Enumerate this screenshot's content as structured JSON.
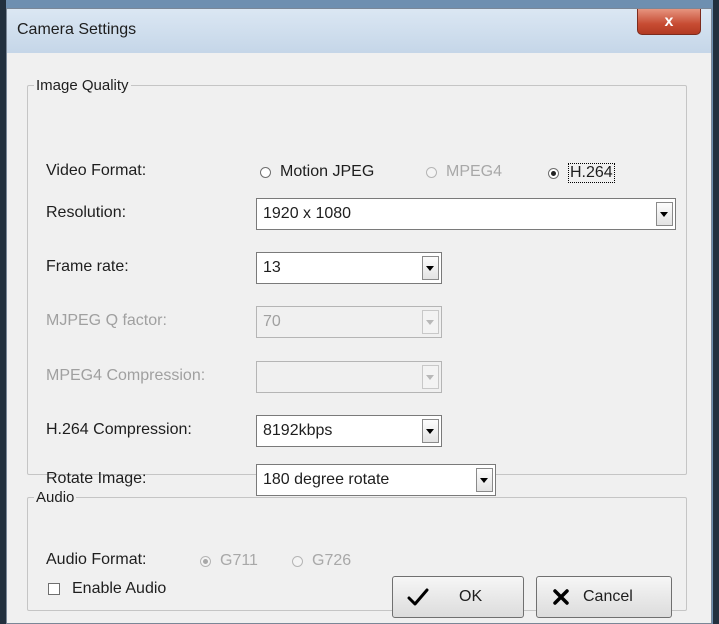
{
  "window": {
    "title": "Camera Settings",
    "close_label": "x"
  },
  "image_quality": {
    "legend": "Image Quality",
    "video_format": {
      "label": "Video Format:",
      "options": [
        {
          "label": "Motion JPEG",
          "selected": false,
          "enabled": true
        },
        {
          "label": "MPEG4",
          "selected": false,
          "enabled": false
        },
        {
          "label": "H.264",
          "selected": true,
          "enabled": true
        }
      ]
    },
    "resolution": {
      "label": "Resolution:",
      "value": "1920 x 1080"
    },
    "frame_rate": {
      "label": "Frame rate:",
      "value": "13"
    },
    "mjpeg_q": {
      "label": "MJPEG Q factor:",
      "value": "70",
      "enabled": false
    },
    "mpeg4_compression": {
      "label": "MPEG4 Compression:",
      "value": "",
      "enabled": false
    },
    "h264_compression": {
      "label": "H.264 Compression:",
      "value": "8192kbps"
    },
    "rotate_image": {
      "label": "Rotate Image:",
      "value": "180 degree rotate"
    }
  },
  "audio": {
    "legend": "Audio",
    "audio_format": {
      "label": "Audio Format:",
      "options": [
        {
          "label": "G711",
          "selected": true,
          "enabled": false
        },
        {
          "label": "G726",
          "selected": false,
          "enabled": false
        }
      ]
    },
    "enable_audio": {
      "label": "Enable Audio",
      "checked": false
    }
  },
  "buttons": {
    "ok": "OK",
    "cancel": "Cancel"
  },
  "colors": {
    "title_bar": "#c5d6e8",
    "close_button": "#c74c33",
    "dialog_bg": "#f0f0f0",
    "disabled_text": "#a0a0a0"
  }
}
